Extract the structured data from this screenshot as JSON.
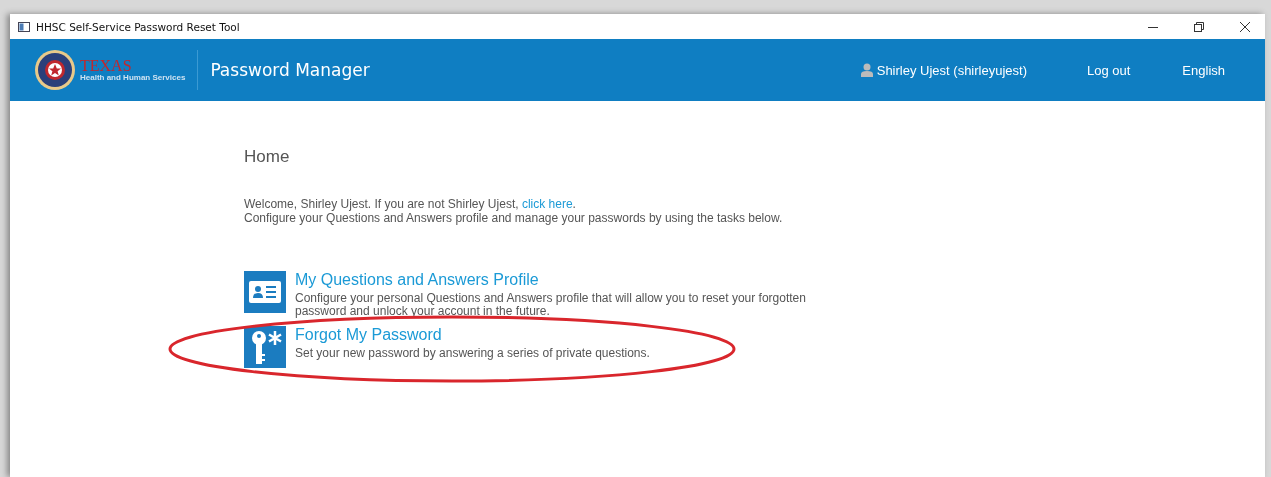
{
  "window": {
    "title": "HHSC Self-Service Password Reset Tool"
  },
  "header": {
    "logo_title": "TEXAS",
    "logo_subtitle": "Health and Human Services",
    "app_name": "Password Manager",
    "user": "Shirley Ujest (shirleyujest)",
    "logout": "Log out",
    "language": "English"
  },
  "page": {
    "heading": "Home",
    "welcome": "Welcome, Shirley Ujest. If you are not Shirley Ujest,",
    "welcome_link": "click here",
    "welcome_end": ".",
    "intro": "Configure your Questions and Answers profile and manage your passwords by using the tasks below."
  },
  "tasks": [
    {
      "kind": "profile",
      "title": "My Questions and Answers Profile",
      "description": "Configure your personal Questions and Answers profile that will allow you to reset your forgotten password and unlock your account in the future.",
      "highlighted": false
    },
    {
      "kind": "password",
      "title": "Forgot My Password",
      "description": "Set your new password by answering a series of private questions.",
      "highlighted": true
    }
  ]
}
